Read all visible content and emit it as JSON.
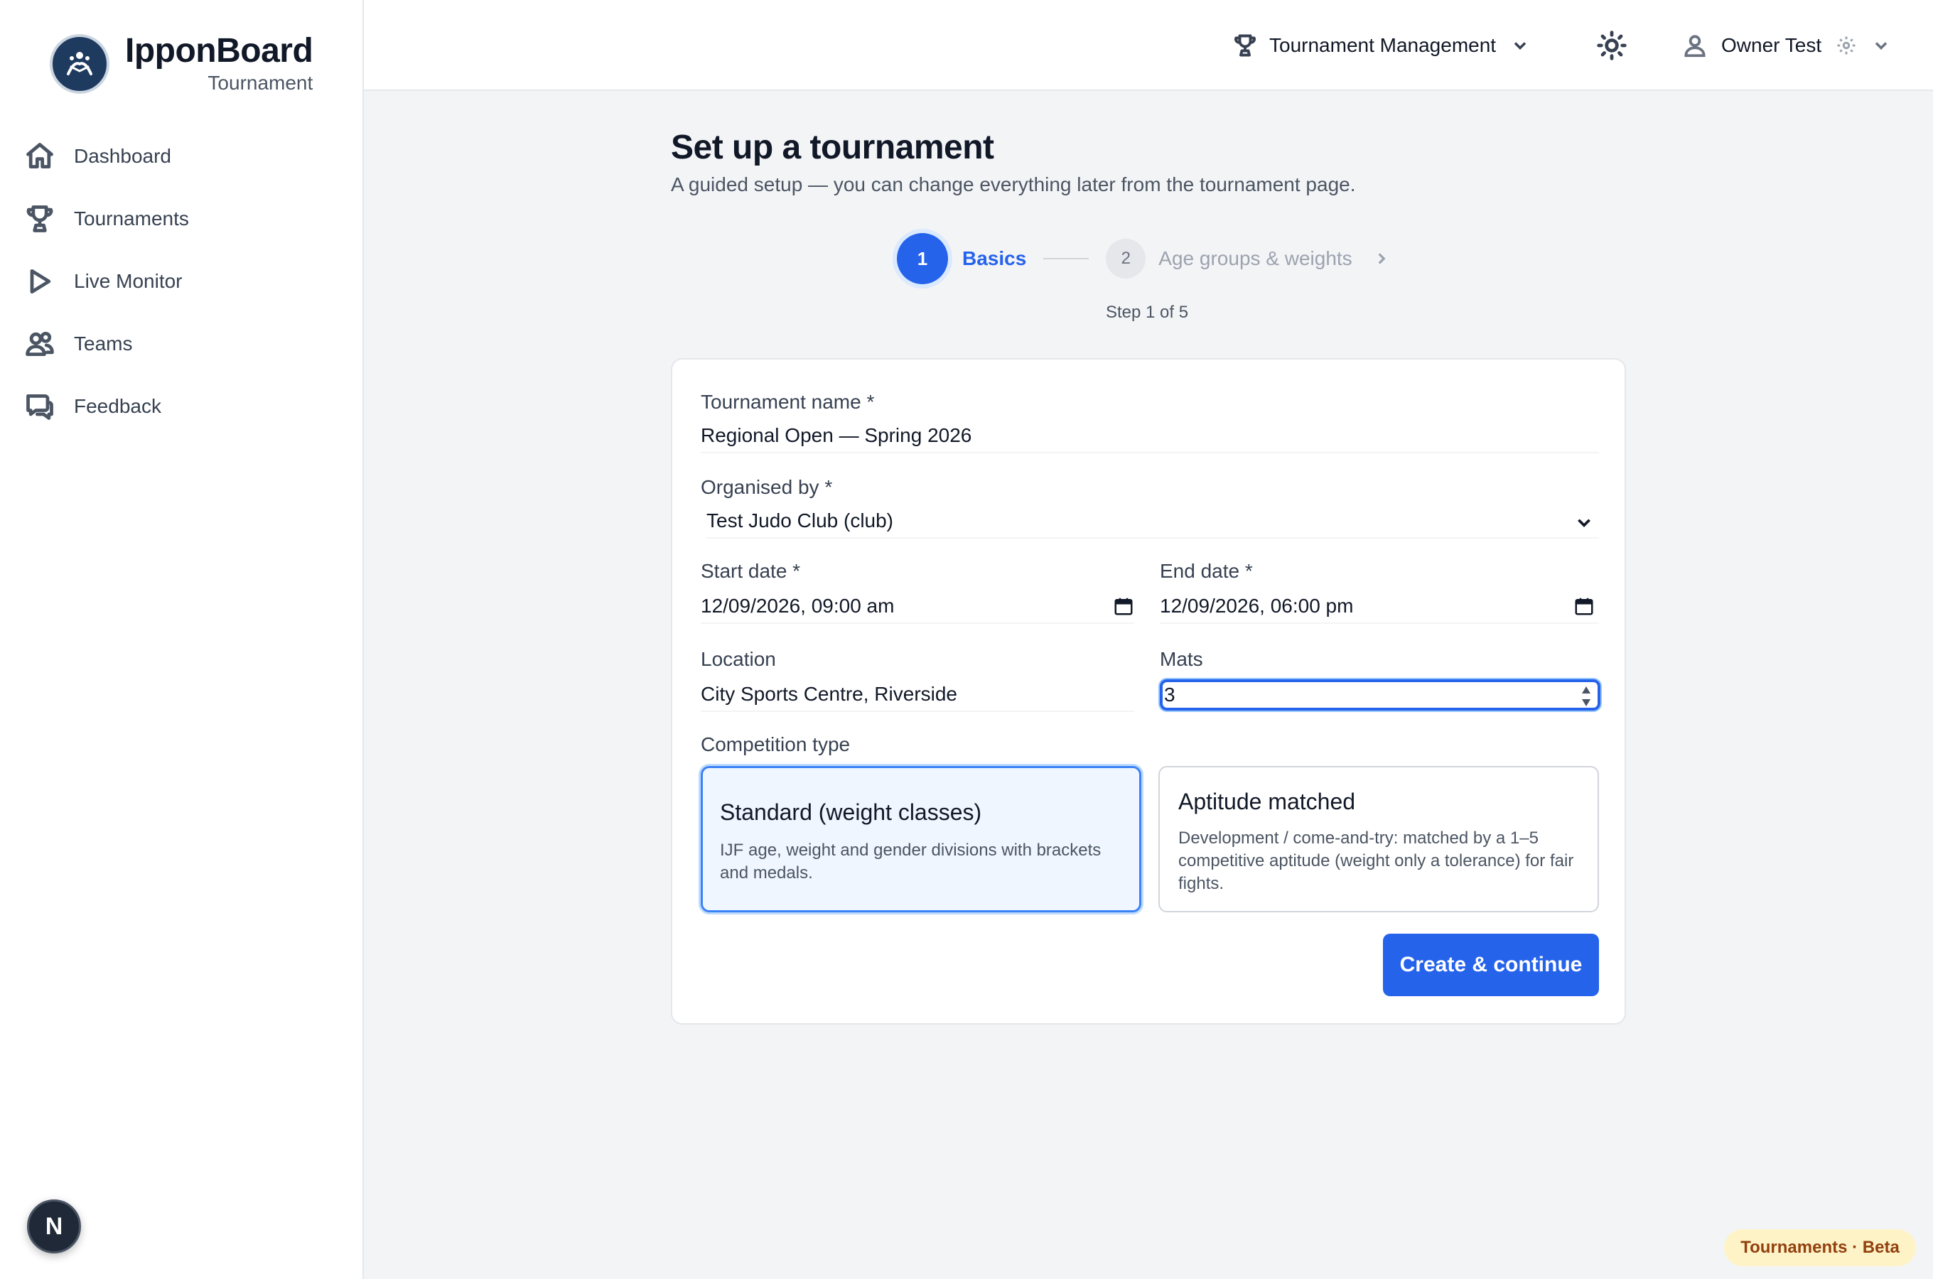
{
  "brand": {
    "name": "IpponBoard",
    "subtitle": "Tournament"
  },
  "sidebar": {
    "items": [
      {
        "label": "Dashboard",
        "icon": "home-icon"
      },
      {
        "label": "Tournaments",
        "icon": "trophy-icon"
      },
      {
        "label": "Live Monitor",
        "icon": "play-icon"
      },
      {
        "label": "Teams",
        "icon": "users-icon"
      },
      {
        "label": "Feedback",
        "icon": "chat-icon"
      }
    ],
    "dev_badge": "N"
  },
  "header": {
    "menu_label": "Tournament Management",
    "user_name": "Owner Test"
  },
  "main": {
    "title": "Set up a tournament",
    "subtitle": "A guided setup — you can change everything later from the tournament page.",
    "stepper": {
      "steps": [
        {
          "number": "1",
          "label": "Basics",
          "state": "active"
        },
        {
          "number": "2",
          "label": "Age groups & weights",
          "state": "upcoming"
        }
      ],
      "progress_text": "Step 1 of 5"
    },
    "form": {
      "name_label": "Tournament name *",
      "name_value": "Regional Open — Spring 2026",
      "organiser_label": "Organised by *",
      "organiser_value": "Test Judo Club (club)",
      "start_label": "Start date *",
      "start_value": "12/09/2026, 09:00 am",
      "end_label": "End date *",
      "end_value": "12/09/2026, 06:00 pm",
      "location_label": "Location",
      "location_value": "City Sports Centre, Riverside",
      "mats_label": "Mats",
      "mats_value": "3",
      "competition_label": "Competition type",
      "options": [
        {
          "title": "Standard (weight classes)",
          "description": "IJF age, weight and gender divisions with brackets and medals.",
          "selected": true
        },
        {
          "title": "Aptitude matched",
          "description": "Development / come-and-try: matched by a 1–5 competitive aptitude (weight only a tolerance) for fair fights.",
          "selected": false
        }
      ],
      "submit_label": "Create & continue"
    }
  },
  "footer_badge": "Tournaments · Beta",
  "colors": {
    "primary": "#2563eb",
    "primary_light": "#eff6ff",
    "beta_bg": "#fef3c7",
    "beta_text": "#92400e"
  }
}
